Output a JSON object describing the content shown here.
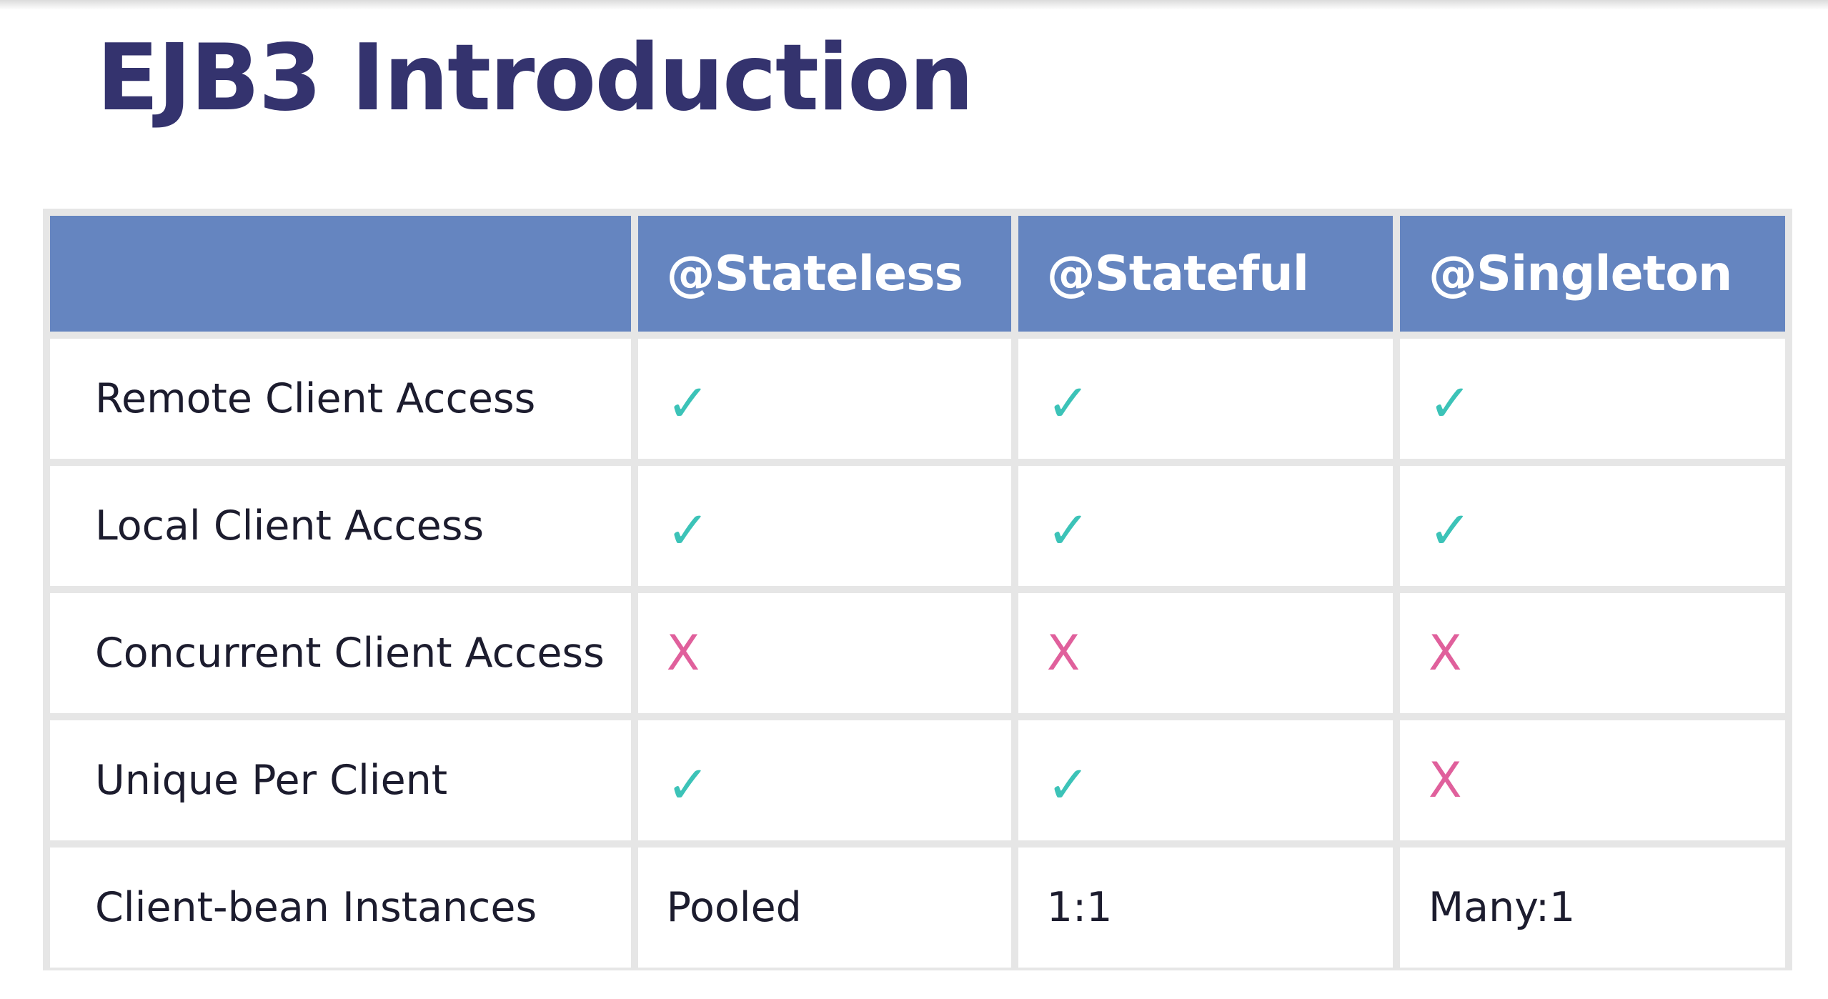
{
  "slide": {
    "title": "EJB3 Introduction"
  },
  "table": {
    "columns": [
      "",
      "@Stateless",
      "@Stateful",
      "@Singleton"
    ],
    "rows": [
      {
        "label": "Remote Client Access",
        "cells": [
          {
            "kind": "check",
            "text": "✓"
          },
          {
            "kind": "check",
            "text": "✓"
          },
          {
            "kind": "check",
            "text": "✓"
          }
        ]
      },
      {
        "label": "Local Client Access",
        "cells": [
          {
            "kind": "check",
            "text": "✓"
          },
          {
            "kind": "check",
            "text": "✓"
          },
          {
            "kind": "check",
            "text": "✓"
          }
        ]
      },
      {
        "label": "Concurrent Client Access",
        "cells": [
          {
            "kind": "cross",
            "text": "X"
          },
          {
            "kind": "cross",
            "text": "X"
          },
          {
            "kind": "cross",
            "text": "X"
          }
        ]
      },
      {
        "label": "Unique Per Client",
        "cells": [
          {
            "kind": "check",
            "text": "✓"
          },
          {
            "kind": "check",
            "text": "✓"
          },
          {
            "kind": "cross",
            "text": "X"
          }
        ]
      },
      {
        "label": "Client-bean Instances",
        "cells": [
          {
            "kind": "text",
            "text": "Pooled"
          },
          {
            "kind": "text",
            "text": "1:1"
          },
          {
            "kind": "text",
            "text": "Many:1"
          }
        ]
      }
    ]
  },
  "colors": {
    "title": "#34336e",
    "header_bg": "#6585c0",
    "header_text": "#ffffff",
    "grid_line": "#e6e6e6",
    "check": "#3cc3b8",
    "cross": "#e0609c"
  },
  "icons": {
    "check": "check-icon",
    "cross": "cross-icon"
  }
}
